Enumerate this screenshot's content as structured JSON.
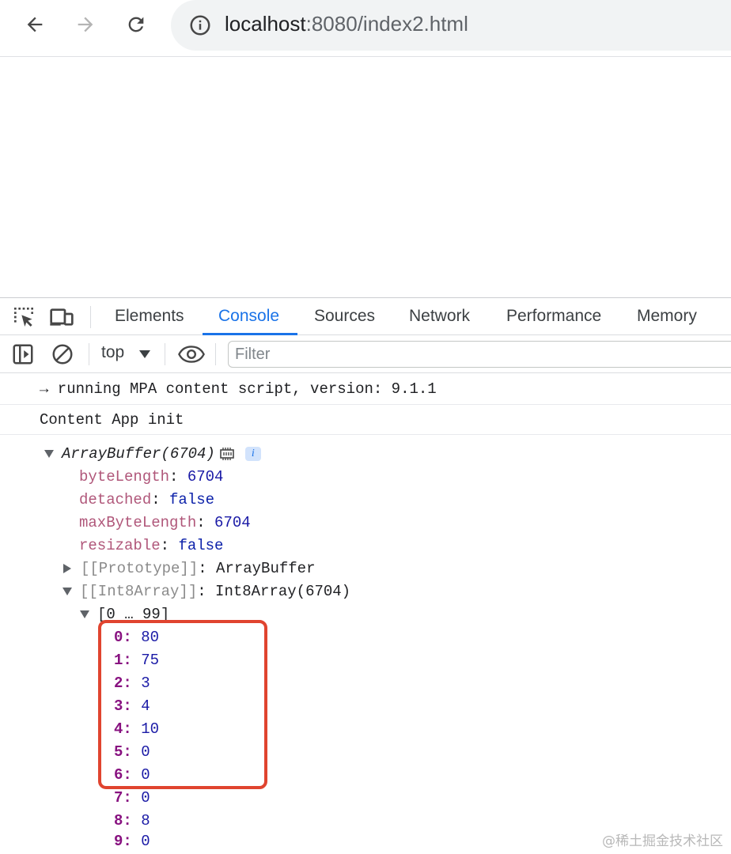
{
  "browser": {
    "url_host": "localhost",
    "url_path": ":8080/index2.html"
  },
  "devtools": {
    "tabs": [
      {
        "label": "Elements"
      },
      {
        "label": "Console",
        "active": true
      },
      {
        "label": "Sources"
      },
      {
        "label": "Network"
      },
      {
        "label": "Performance"
      },
      {
        "label": "Memory"
      }
    ],
    "toolbar": {
      "context": "top",
      "filter_placeholder": "Filter"
    }
  },
  "console": {
    "messages": [
      "→ running MPA content script, version: 9.1.1",
      "Content App init"
    ],
    "object": {
      "header": "ArrayBuffer(6704)",
      "info_badge": "i",
      "props": [
        {
          "key": "byteLength",
          "value": "6704"
        },
        {
          "key": "detached",
          "value": "false"
        },
        {
          "key": "maxByteLength",
          "value": "6704"
        },
        {
          "key": "resizable",
          "value": "false"
        }
      ],
      "prototype": {
        "key": "[[Prototype]]",
        "value": "ArrayBuffer"
      },
      "int8": {
        "key": "[[Int8Array]]",
        "value": "Int8Array(6704)"
      },
      "range": "[0 … 99]",
      "items": [
        {
          "index": "0",
          "value": "80"
        },
        {
          "index": "1",
          "value": "75"
        },
        {
          "index": "2",
          "value": "3"
        },
        {
          "index": "3",
          "value": "4"
        },
        {
          "index": "4",
          "value": "10"
        },
        {
          "index": "5",
          "value": "0"
        },
        {
          "index": "6",
          "value": "0"
        },
        {
          "index": "7",
          "value": "0"
        },
        {
          "index": "8",
          "value": "8"
        },
        {
          "index": "9",
          "value": "0"
        }
      ]
    }
  },
  "watermark": "@稀土掘金技术社区",
  "colors": {
    "accent": "#1a73e8",
    "highlight": "#e0442f"
  }
}
